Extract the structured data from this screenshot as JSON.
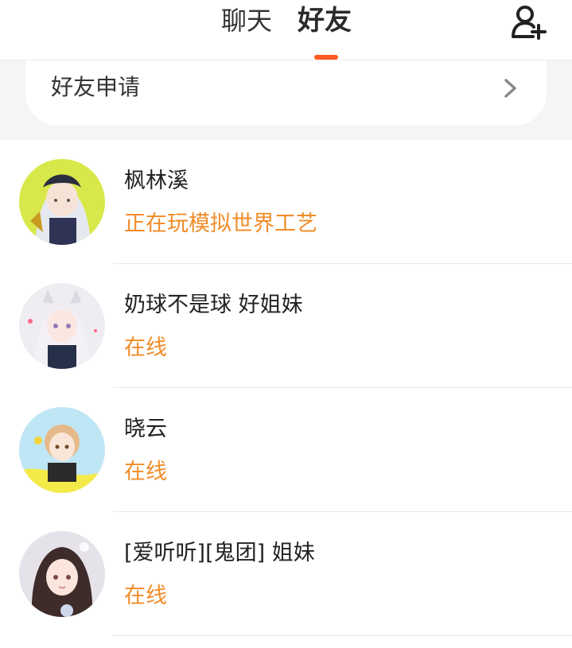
{
  "header": {
    "tabs": [
      {
        "label": "聊天",
        "active": false
      },
      {
        "label": "好友",
        "active": true
      }
    ],
    "accent_color": "#ff5a1f",
    "add_friend_icon": "add-user-icon"
  },
  "friend_requests": {
    "label": "好友申请",
    "icon": "chevron-right-icon"
  },
  "status_color": "#f28c28",
  "friends": [
    {
      "name": "枫林溪",
      "status": "正在玩模拟世界工艺"
    },
    {
      "name": "奶球不是球 好姐妹",
      "status": "在线"
    },
    {
      "name": "晓云",
      "status": "在线"
    },
    {
      "name": "[爱听听][鬼团] 姐妹",
      "status": "在线"
    }
  ]
}
